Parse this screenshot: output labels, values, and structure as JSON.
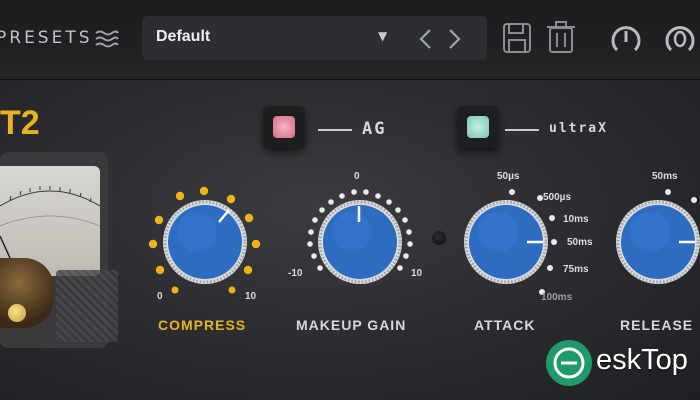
{
  "header": {
    "presets_label": "PRESETS",
    "preset_name": "Default",
    "icons": [
      "hamburger-icon",
      "chevron-down-icon",
      "arrow-left-icon",
      "arrow-right-icon",
      "save-icon",
      "trash-icon",
      "power-icon",
      "bypass-icon"
    ]
  },
  "brand": {
    "text": "T2"
  },
  "switches": {
    "ag": {
      "label": "AG",
      "led_color": "#e6869b"
    },
    "ultrax": {
      "label": "ultraX",
      "led_color": "#8fd4c3"
    }
  },
  "knobs": {
    "compress": {
      "label": "COMPRESS",
      "min": "0",
      "max": "10",
      "label_color": "#e6b422"
    },
    "makeup_gain": {
      "label": "MAKEUP GAIN",
      "min": "-10",
      "max": "10",
      "center": "0"
    },
    "attack": {
      "label": "ATTACK",
      "values": [
        "50µs",
        "500µs",
        "10ms",
        "50ms",
        "75ms",
        "100ms"
      ]
    },
    "release": {
      "label": "RELEASE",
      "values": [
        "50ms"
      ]
    }
  },
  "colors": {
    "knob_blue": "#2d6cc0",
    "brand_yellow": "#e6b422",
    "dot_yellow": "#f0b21a"
  },
  "watermark": {
    "text": "eskTop"
  }
}
